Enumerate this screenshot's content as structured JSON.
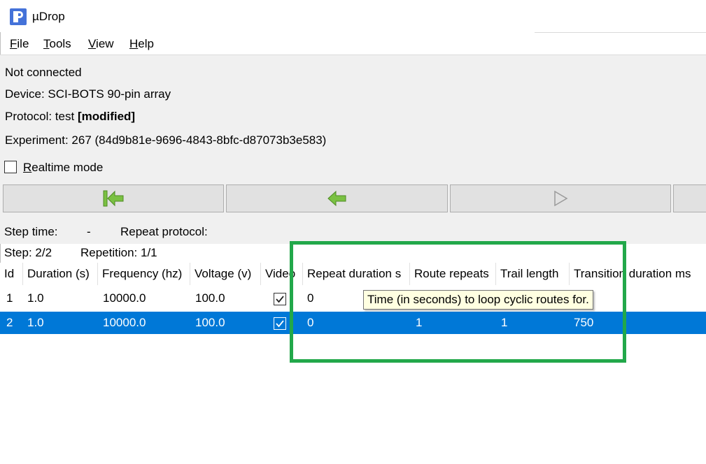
{
  "window": {
    "title": "µDrop"
  },
  "menu": [
    {
      "mnemonic": "F",
      "rest": "ile"
    },
    {
      "mnemonic": "T",
      "rest": "ools"
    },
    {
      "mnemonic": "V",
      "rest": "iew"
    },
    {
      "mnemonic": "H",
      "rest": "elp"
    }
  ],
  "status": {
    "connection": "Not connected",
    "device": "Device: SCI-BOTS 90-pin array",
    "protocol_prefix": "Protocol: test ",
    "protocol_flag": "[modified]",
    "experiment": "Experiment: 267 (84d9b81e-9696-4843-8bfc-d87073b3e583)"
  },
  "realtime": {
    "mnemonic": "R",
    "rest": "ealtime mode",
    "checked": false
  },
  "nav_icons": [
    "first-step-icon",
    "previous-step-icon",
    "play-icon"
  ],
  "stats": {
    "step_time_label": "Step time:",
    "step_time_value": "-",
    "repeat_protocol_label": "Repeat protocol:",
    "step": "Step: 2/2",
    "repetition": "Repetition: 1/1"
  },
  "table": {
    "columns": [
      "Id",
      "Duration (s)",
      "Frequency (hz)",
      "Voltage (v)",
      "Video",
      "Repeat duration s",
      "Route repeats",
      "Trail length",
      "Transition duration ms"
    ],
    "rows": [
      {
        "id": "1",
        "duration": "1.0",
        "frequency": "10000.0",
        "voltage": "100.0",
        "video": true,
        "repeat_duration": "0",
        "route_repeats": "",
        "trail_length": "",
        "transition": ""
      },
      {
        "id": "2",
        "duration": "1.0",
        "frequency": "10000.0",
        "voltage": "100.0",
        "video": true,
        "repeat_duration": "0",
        "route_repeats": "1",
        "trail_length": "1",
        "transition": "750"
      }
    ]
  },
  "tooltip": "Time (in seconds) to loop cyclic routes for.",
  "colors": {
    "selection": "#0078d7",
    "highlight": "#22a84a",
    "nav_arrow": "#7ac142"
  }
}
